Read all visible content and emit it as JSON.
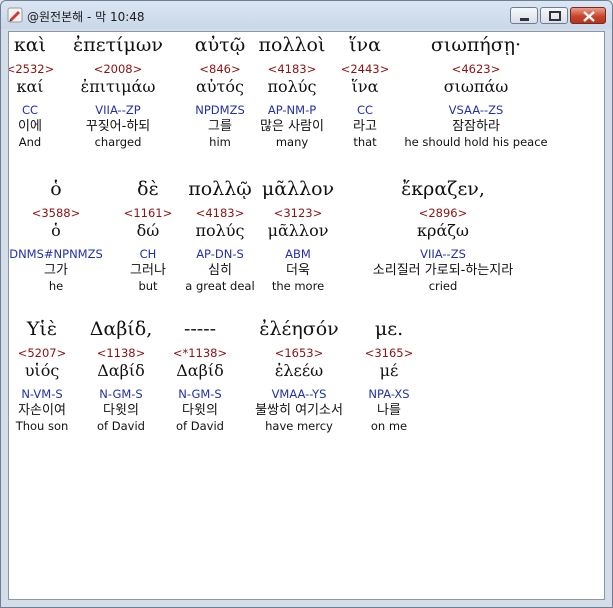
{
  "window": {
    "title": "@원전본해 - 막 10:48"
  },
  "rows": [
    [
      {
        "greek": "καὶ",
        "strong": "<2532>",
        "lemma": "καί",
        "morph": "CC",
        "korean": "이에",
        "english": "And"
      },
      {
        "greek": "ἐπετίμων",
        "strong": "<2008>",
        "lemma": "ἐπιτιμάω",
        "morph": "VIIA--ZP",
        "korean": "꾸짖어-하되",
        "english": "charged"
      },
      {
        "greek": "αὐτῷ",
        "strong": "<846>",
        "lemma": "αὐτός",
        "morph": "NPDMZS",
        "korean": "그를",
        "english": "him"
      },
      {
        "greek": "πολλοὶ",
        "strong": "<4183>",
        "lemma": "πολύς",
        "morph": "AP-NM-P",
        "korean": "많은 사람이",
        "english": "many"
      },
      {
        "greek": "ἵνα",
        "strong": "<2443>",
        "lemma": "ἵνα",
        "morph": "CC",
        "korean": "라고",
        "english": "that"
      },
      {
        "greek": "σιωπήσῃ·",
        "strong": "<4623>",
        "lemma": "σιωπάω",
        "morph": "VSAA--ZS",
        "korean": "잠잠하라",
        "english": "he should hold his peace"
      }
    ],
    [
      {
        "greek": "ὁ",
        "strong": "<3588>",
        "lemma": "ὁ",
        "morph": "DNMS#NPNMZS",
        "korean": "그가",
        "english": "he"
      },
      {
        "greek": "δὲ",
        "strong": "<1161>",
        "lemma": "δώ",
        "morph": "CH",
        "korean": "그러나",
        "english": "but"
      },
      {
        "greek": "πολλῷ",
        "strong": "<4183>",
        "lemma": "πολύς",
        "morph": "AP-DN-S",
        "korean": "심히",
        "english": "a great deal"
      },
      {
        "greek": "μᾶλλον",
        "strong": "<3123>",
        "lemma": "μᾶλλον",
        "morph": "ABM",
        "korean": "더욱",
        "english": "the more"
      },
      {
        "greek": "ἔκραζεν,",
        "strong": "<2896>",
        "lemma": "κράζω",
        "morph": "VIIA--ZS",
        "korean": "소리질러 가로되-하는지라",
        "english": "cried"
      }
    ],
    [
      {
        "greek": "Υἱὲ",
        "strong": "<5207>",
        "lemma": "υἱός",
        "morph": "N-VM-S",
        "korean": "자손이여",
        "english": "Thou son"
      },
      {
        "greek": "Δαβίδ,",
        "strong": "<1138>",
        "lemma": "Δαβίδ",
        "morph": "N-GM-S",
        "korean": "다윗의",
        "english": "of David"
      },
      {
        "greek": "-----",
        "strong": "<*1138>",
        "lemma": "Δαβίδ",
        "morph": "N-GM-S",
        "korean": "다윗의",
        "english": "of David"
      },
      {
        "greek": "ἐλέησόν",
        "strong": "<1653>",
        "lemma": "ἐλεέω",
        "morph": "VMAA--YS",
        "korean": "불쌍히 여기소서",
        "english": "have mercy"
      },
      {
        "greek": "με.",
        "strong": "<3165>",
        "lemma": "μέ",
        "morph": "NPA-XS",
        "korean": "나를",
        "english": "on me"
      }
    ]
  ]
}
